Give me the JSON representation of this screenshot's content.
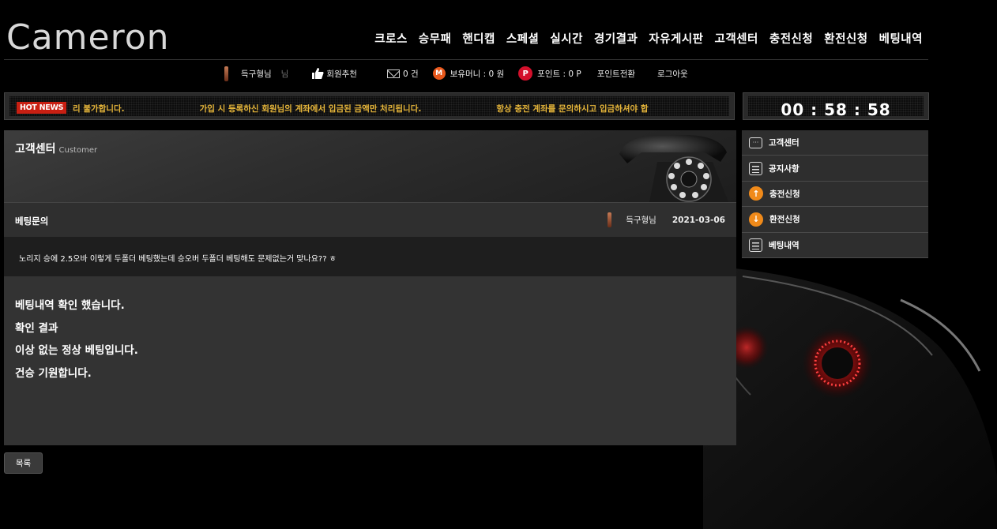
{
  "brand": {
    "logo": "Cameron"
  },
  "nav": [
    "크로스",
    "승무패",
    "핸디캡",
    "스페셜",
    "실시간",
    "경기결과",
    "자유게시판",
    "고객센터",
    "충전신청",
    "환전신청",
    "베팅내역"
  ],
  "user": {
    "name": "득구형님",
    "suffix": "님",
    "recommend": "회원추천",
    "messages": "0 건",
    "money_label": "보유머니 : 0 원",
    "money_icon": "M",
    "point_label": "포인트 : 0 P",
    "point_icon": "P",
    "point_convert": "포인트전환",
    "logout": "로그아웃"
  },
  "news": {
    "badge": "HOT NEWS",
    "items": [
      "리 불가합니다.",
      "가입 시 등록하신 회원님의 계좌에서 입금된 금액만 처리됩니다.",
      "항상 충전 계좌를 문의하시고 입금하셔야 합"
    ]
  },
  "timer": "00 : 58 : 58",
  "section": {
    "title": "고객센터",
    "subtitle": "Customer"
  },
  "post": {
    "subject": "베팅문의",
    "author": "득구형님",
    "date": "2021-03-06",
    "question": "노리지 승에 2.5오바 이렇게 두폴더 베팅했는데 승오버 두폴더 베팅해도 문제없는거 맞나요?? ㅎ",
    "answer": [
      "베팅내역 확인 했습니다.",
      "확인 결과",
      "이상 없는 정상 베팅입니다.",
      "건승 기원합니다."
    ]
  },
  "list_button": "목록",
  "side_menu": [
    {
      "label": "고객센터",
      "icon": "chat-icon"
    },
    {
      "label": "공지사항",
      "icon": "list-icon"
    },
    {
      "label": "충전신청",
      "icon": "arrow-up-icon"
    },
    {
      "label": "환전신청",
      "icon": "arrow-down-icon"
    },
    {
      "label": "베팅내역",
      "icon": "list-icon"
    }
  ],
  "colors": {
    "ticker": "#e8b73a",
    "hot": "#c81f12",
    "accent_orange": "#f08a1a"
  }
}
